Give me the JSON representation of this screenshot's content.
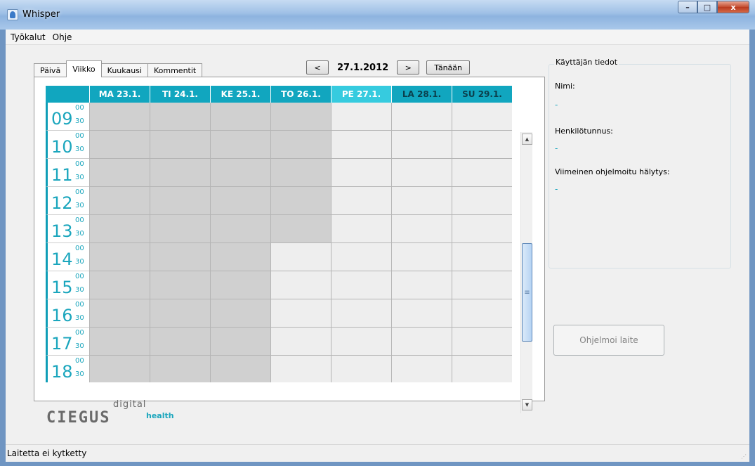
{
  "window": {
    "title": "Whisper",
    "controls": {
      "minimize": "–",
      "maximize": "□",
      "close": "x"
    }
  },
  "menu": [
    "Työkalut",
    "Ohje"
  ],
  "tabs": [
    {
      "label": "Päivä",
      "active": false
    },
    {
      "label": "Viikko",
      "active": true
    },
    {
      "label": "Kuukausi",
      "active": false
    },
    {
      "label": "Kommentit",
      "active": false
    }
  ],
  "date_nav": {
    "prev": "<",
    "current": "27.1.2012",
    "next": ">",
    "today": "Tänään"
  },
  "calendar": {
    "days": [
      {
        "label": "MA 23.1.",
        "today": false,
        "weekend": false
      },
      {
        "label": "TI 24.1.",
        "today": false,
        "weekend": false
      },
      {
        "label": "KE 25.1.",
        "today": false,
        "weekend": false
      },
      {
        "label": "TO 26.1.",
        "today": false,
        "weekend": false
      },
      {
        "label": "PE 27.1.",
        "today": true,
        "weekend": false
      },
      {
        "label": "LA 28.1.",
        "today": false,
        "weekend": true
      },
      {
        "label": "SU 29.1.",
        "today": false,
        "weekend": true
      }
    ],
    "hours": [
      {
        "hour": "09",
        "m1": "00",
        "m2": "30",
        "busy": [
          true,
          true,
          true,
          true,
          false,
          false,
          false
        ]
      },
      {
        "hour": "10",
        "m1": "00",
        "m2": "30",
        "busy": [
          true,
          true,
          true,
          true,
          false,
          false,
          false
        ]
      },
      {
        "hour": "11",
        "m1": "00",
        "m2": "30",
        "busy": [
          true,
          true,
          true,
          true,
          false,
          false,
          false
        ]
      },
      {
        "hour": "12",
        "m1": "00",
        "m2": "30",
        "busy": [
          true,
          true,
          true,
          true,
          false,
          false,
          false
        ]
      },
      {
        "hour": "13",
        "m1": "00",
        "m2": "30",
        "busy": [
          true,
          true,
          true,
          true,
          false,
          false,
          false
        ]
      },
      {
        "hour": "14",
        "m1": "00",
        "m2": "30",
        "busy": [
          true,
          true,
          true,
          false,
          false,
          false,
          false
        ]
      },
      {
        "hour": "15",
        "m1": "00",
        "m2": "30",
        "busy": [
          true,
          true,
          true,
          false,
          false,
          false,
          false
        ]
      },
      {
        "hour": "16",
        "m1": "00",
        "m2": "30",
        "busy": [
          true,
          true,
          true,
          false,
          false,
          false,
          false
        ]
      },
      {
        "hour": "17",
        "m1": "00",
        "m2": "30",
        "busy": [
          true,
          true,
          true,
          false,
          false,
          false,
          false
        ]
      },
      {
        "hour": "18",
        "m1": "00",
        "m2": "30",
        "busy": [
          true,
          true,
          true,
          false,
          false,
          false,
          false
        ]
      }
    ]
  },
  "logo": {
    "digital": "digital",
    "name": "CIEGUS",
    "health": "health"
  },
  "user_info": {
    "legend": "Käyttäjän tiedot",
    "name_label": "Nimi:",
    "name_value": "-",
    "id_label": "Henkilötunnus:",
    "id_value": "-",
    "alarm_label": "Viimeinen ohjelmoitu hälytys:",
    "alarm_value": "-"
  },
  "program_button": "Ohjelmoi laite",
  "status": "Laitetta ei kytketty",
  "colors": {
    "accent": "#11a6bf",
    "today": "#36cbdf",
    "busy": "#d0d0d0",
    "free": "#eeeeee"
  }
}
